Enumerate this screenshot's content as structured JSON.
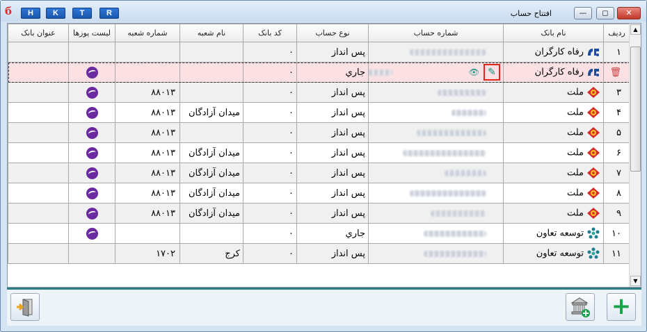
{
  "window": {
    "title": "افتتاح حساب",
    "hotkeys": [
      "H",
      "K",
      "T",
      "R"
    ],
    "controls": {
      "minimize": "—",
      "restore": "◻",
      "close": "✕"
    }
  },
  "table": {
    "columns": [
      "ردیف",
      "نام بانک",
      "شماره حساب",
      "نوع حساب",
      "کد بانک",
      "نام شعبه",
      "شماره شعبه",
      "لیست پوزها",
      "عنوان بانک"
    ],
    "rows": [
      {
        "idx": "۱",
        "bank": "رفاه کارگران",
        "bank_icon": "refah-logo",
        "type": "پس انداز",
        "code": "۰",
        "branch": "",
        "branch_no": "",
        "pos": false
      },
      {
        "idx": "",
        "bank": "رفاه کارگران",
        "bank_icon": "refah-logo",
        "type": "جاري",
        "code": "۰",
        "branch": "",
        "branch_no": "",
        "pos": true,
        "selected": true
      },
      {
        "idx": "۳",
        "bank": "ملت",
        "bank_icon": "mellat-logo",
        "type": "پس انداز",
        "code": "۰",
        "branch": "",
        "branch_no": "۸۸۰۱۳",
        "pos": true
      },
      {
        "idx": "۴",
        "bank": "ملت",
        "bank_icon": "mellat-logo",
        "type": "پس انداز",
        "code": "۰",
        "branch": "میدان آزادگان",
        "branch_no": "۸۸۰۱۳",
        "pos": true
      },
      {
        "idx": "۵",
        "bank": "ملت",
        "bank_icon": "mellat-logo",
        "type": "پس انداز",
        "code": "۰",
        "branch": "",
        "branch_no": "۸۸۰۱۳",
        "pos": true
      },
      {
        "idx": "۶",
        "bank": "ملت",
        "bank_icon": "mellat-logo",
        "type": "پس انداز",
        "code": "۰",
        "branch": "میدان آزادگان",
        "branch_no": "۸۸۰۱۳",
        "pos": true
      },
      {
        "idx": "۷",
        "bank": "ملت",
        "bank_icon": "mellat-logo",
        "type": "پس انداز",
        "code": "۰",
        "branch": "میدان آزادگان",
        "branch_no": "۸۸۰۱۳",
        "pos": true
      },
      {
        "idx": "۸",
        "bank": "ملت",
        "bank_icon": "mellat-logo",
        "type": "پس انداز",
        "code": "۰",
        "branch": "میدان آزادگان",
        "branch_no": "۸۸۰۱۳",
        "pos": true
      },
      {
        "idx": "۹",
        "bank": "ملت",
        "bank_icon": "mellat-logo",
        "type": "پس انداز",
        "code": "۰",
        "branch": "میدان آزادگان",
        "branch_no": "۸۸۰۱۳",
        "pos": true
      },
      {
        "idx": "۱۰",
        "bank": "توسعه تعاون",
        "bank_icon": "taavon-logo",
        "type": "جاري",
        "code": "۰",
        "branch": "",
        "branch_no": "",
        "pos": true
      },
      {
        "idx": "۱۱",
        "bank": "توسعه تعاون",
        "bank_icon": "taavon-logo",
        "type": "پس انداز",
        "code": "۰",
        "branch": "کرج",
        "branch_no": "۱۷۰۲",
        "pos": false
      }
    ]
  },
  "row_actions": {
    "delete_icon": "trash-icon",
    "edit_icon": "pencil-icon",
    "view_icon": "eye-icon"
  },
  "colors": {
    "selected_row": "#fbe1e4",
    "separator": "#2d7d83",
    "add_green": "#1aa24a",
    "edit_highlight": "#e2261d"
  }
}
